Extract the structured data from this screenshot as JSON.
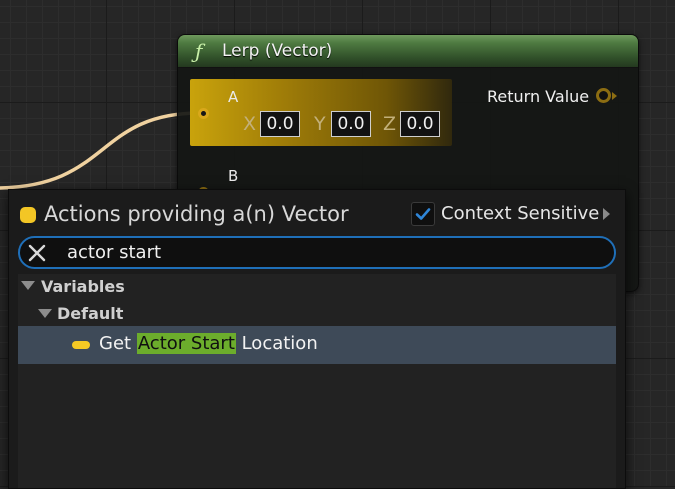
{
  "node": {
    "title": "Lerp (Vector)",
    "icon": "function-icon",
    "pin_a": {
      "label": "A",
      "x_label": "X",
      "x_value": "0.0",
      "y_label": "Y",
      "y_value": "0.0",
      "z_label": "Z",
      "z_value": "0.0"
    },
    "pin_b": {
      "label": "B"
    },
    "return_label": "Return Value",
    "header_color": "#4e7a41",
    "pin_color": "#d9a81b"
  },
  "menu": {
    "title": "Actions providing a(n) Vector",
    "context_sensitive_label": "Context Sensitive",
    "context_sensitive_checked": true,
    "search_value": "actor start",
    "categories": [
      {
        "label": "Variables"
      },
      {
        "label": "Default"
      }
    ],
    "item": {
      "prefix": "Get ",
      "highlight": "Actor Start",
      "suffix": " Location"
    },
    "accent_color": "#1f6fb8",
    "highlight_color": "#6cad2c",
    "selected_row_color": "#3e4a58"
  }
}
